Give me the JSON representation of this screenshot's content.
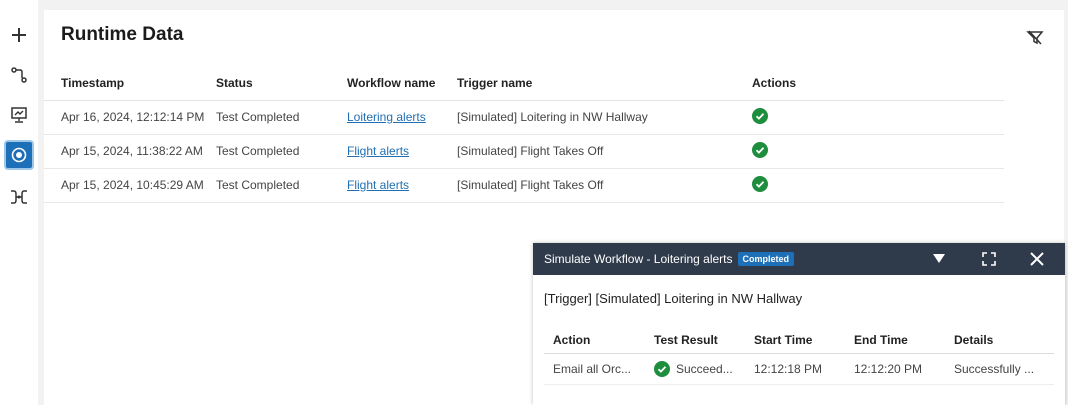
{
  "rail": {
    "items": [
      {
        "icon": "plus-icon"
      },
      {
        "icon": "workflow-icon"
      },
      {
        "icon": "monitor-icon"
      },
      {
        "icon": "runtime-icon",
        "active": true
      },
      {
        "icon": "integration-icon"
      }
    ]
  },
  "page": {
    "title": "Runtime Data"
  },
  "runtime_table": {
    "headers": [
      "Timestamp",
      "Status",
      "Workflow name",
      "Trigger name",
      "Actions"
    ],
    "rows": [
      {
        "timestamp": "Apr 16, 2024, 12:12:14 PM",
        "status": "Test Completed",
        "workflow": "Loitering alerts",
        "trigger": "[Simulated] Loitering in NW Hallway"
      },
      {
        "timestamp": "Apr 15, 2024, 11:38:22 AM",
        "status": "Test Completed",
        "workflow": "Flight alerts",
        "trigger": "[Simulated] Flight Takes Off"
      },
      {
        "timestamp": "Apr 15, 2024, 10:45:29 AM",
        "status": "Test Completed",
        "workflow": "Flight alerts",
        "trigger": "[Simulated] Flight Takes Off"
      }
    ]
  },
  "simulate_panel": {
    "title": "Simulate Workflow - Loitering alerts",
    "badge": "Completed",
    "trigger_line": "[Trigger] [Simulated] Loitering in NW Hallway",
    "headers": [
      "Action",
      "Test Result",
      "Start Time",
      "End Time",
      "Details"
    ],
    "rows": [
      {
        "action": "Email all Orc...",
        "result": "Succeed...",
        "start": "12:12:18 PM",
        "end": "12:12:20 PM",
        "details": "Successfully ..."
      }
    ]
  },
  "colors": {
    "accent": "#1d6fb8",
    "success": "#1e8e3e",
    "header_dark": "#2f3a4a"
  }
}
